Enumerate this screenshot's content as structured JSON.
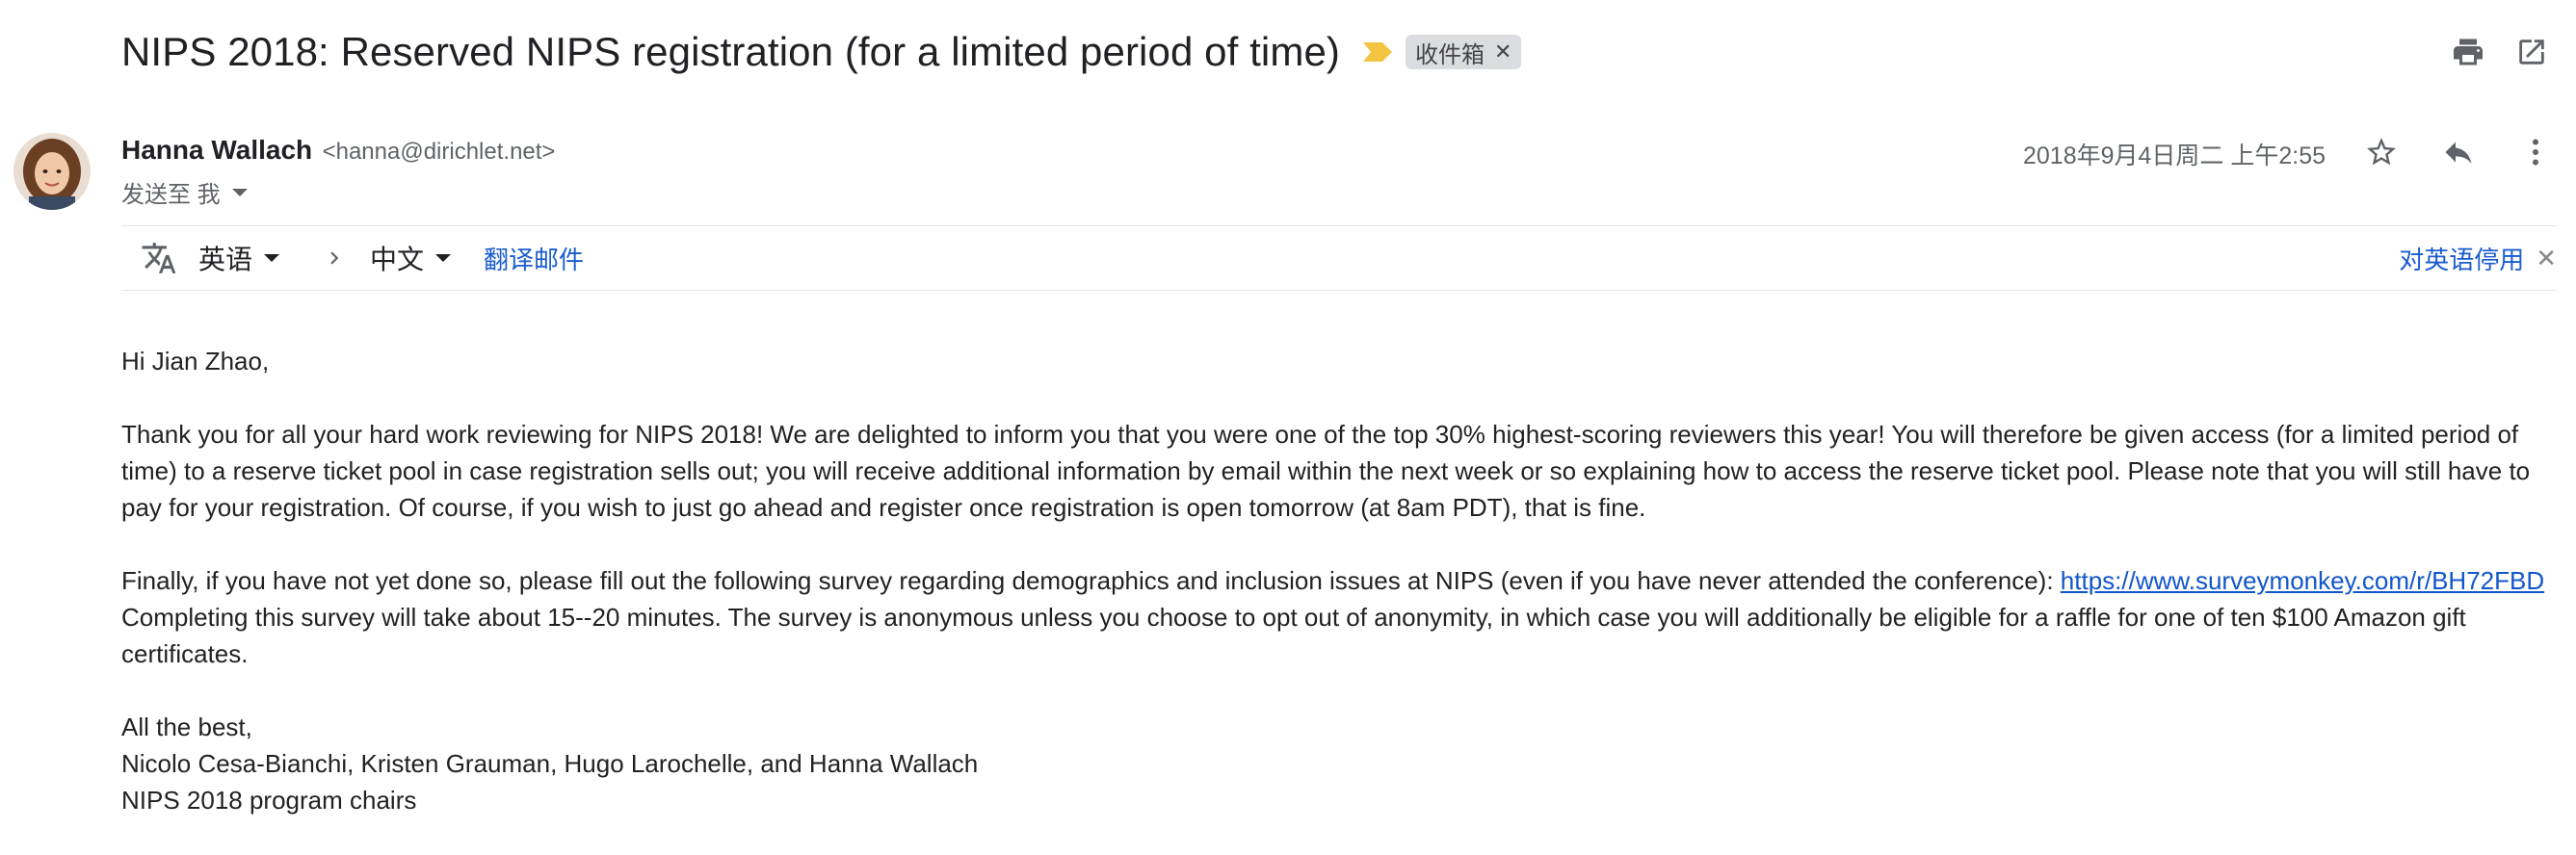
{
  "email": {
    "subject": "NIPS 2018: Reserved NIPS registration (for a limited period of time)",
    "label_chip": "收件箱",
    "sender_name": "Hanna Wallach",
    "sender_email": "<hanna@dirichlet.net>",
    "to_text": "发送至 我",
    "date": "2018年9月4日周二 上午2:55"
  },
  "translate_bar": {
    "source_lang": "英语",
    "target_lang": "中文",
    "translate_link": "翻译邮件",
    "disable_link": "对英语停用"
  },
  "body": {
    "greeting": "Hi Jian Zhao,",
    "paragraph1": "Thank you for all your hard work reviewing for NIPS 2018! We are delighted to inform you that you were one of the top 30% highest-scoring reviewers this year! You will therefore be given access (for a limited period of time) to a reserve ticket pool in case registration sells out; you will receive additional information by email within the next week or so explaining how to access the reserve ticket pool. Please note that you will still have to pay for your registration. Of course, if you wish to just go ahead and register once registration is open tomorrow (at 8am PDT), that is fine.",
    "paragraph2_prefix": "Finally, if you have not yet done so, please fill out the following survey regarding demographics and inclusion issues at NIPS (even if you have never attended the conference): ",
    "survey_link": "https://www.surveymonkey.com/r/BH72FBD",
    "paragraph2_suffix": " Completing this survey will take about 15--20 minutes. The survey is anonymous unless you choose to opt out of anonymity, in which case you will additionally be eligible for a raffle for one of ten $100 Amazon gift certificates.",
    "closing": "All the best,",
    "signature_names": "Nicolo Cesa-Bianchi, Kristen Grauman, Hugo Larochelle, and Hanna Wallach",
    "signature_title": "NIPS 2018 program chairs"
  },
  "icons": {
    "print": "print-icon",
    "open_new_window": "open-in-new-window-icon",
    "star": "star-icon",
    "reply": "reply-icon",
    "more": "more-vertical-icon",
    "translate": "translate-icon",
    "importance": "importance-marker-icon"
  },
  "colors": {
    "link": "#1155cc",
    "importance_marker": "#f4c542",
    "chip_bg": "#dadce0"
  }
}
